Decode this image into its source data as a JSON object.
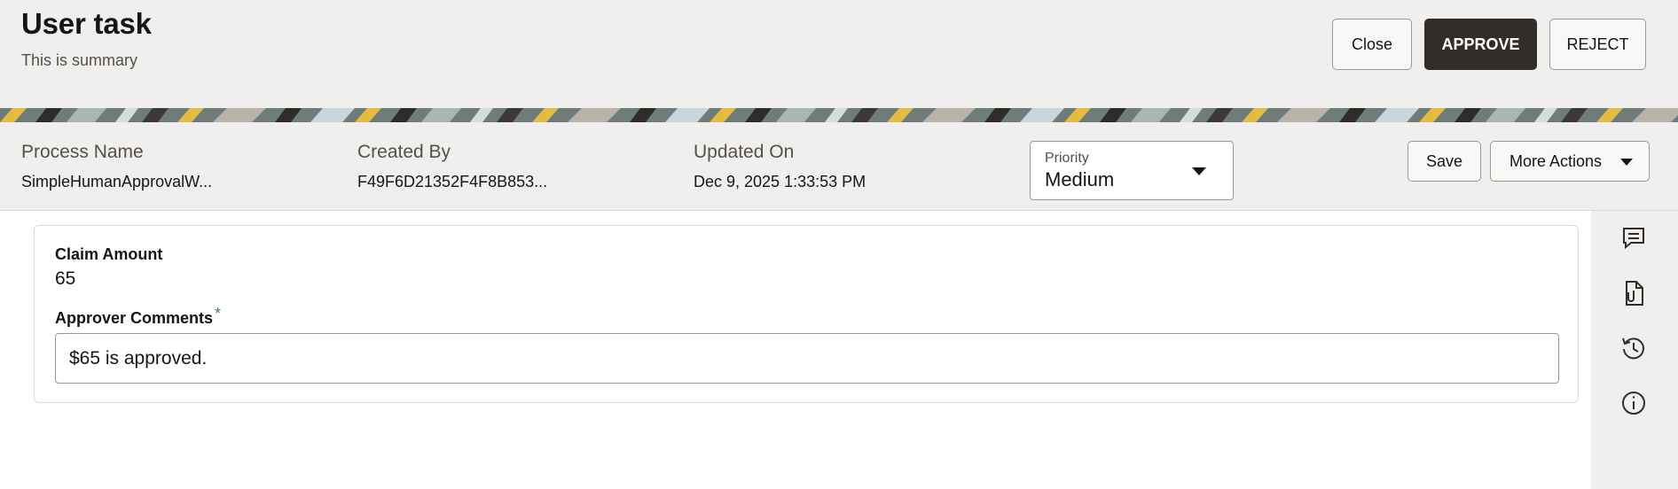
{
  "header": {
    "title": "User task",
    "subtitle": "This is summary",
    "close_label": "Close",
    "approve_label": "APPROVE",
    "reject_label": "REJECT"
  },
  "info": {
    "process_name_label": "Process Name",
    "process_name_value": "SimpleHumanApprovalW...",
    "created_by_label": "Created By",
    "created_by_value": "F49F6D21352F4F8B853...",
    "updated_on_label": "Updated On",
    "updated_on_value": "Dec 9, 2025 1:33:53 PM",
    "priority_label": "Priority",
    "priority_value": "Medium",
    "save_label": "Save",
    "more_actions_label": "More Actions"
  },
  "form": {
    "claim_amount_label": "Claim Amount",
    "claim_amount_value": "65",
    "approver_comments_label": "Approver Comments",
    "required_marker": "*",
    "approver_comments_value": "$65 is approved."
  },
  "sidebar": {
    "icons": [
      "comments-icon",
      "attachments-icon",
      "history-icon",
      "info-icon"
    ]
  },
  "colors": {
    "header_bg": "#f1efed",
    "primary_button": "#312d2a",
    "required_accent": "#427c82",
    "banner_slate": "#6f7c7b",
    "banner_yellow": "#e3bc43"
  }
}
